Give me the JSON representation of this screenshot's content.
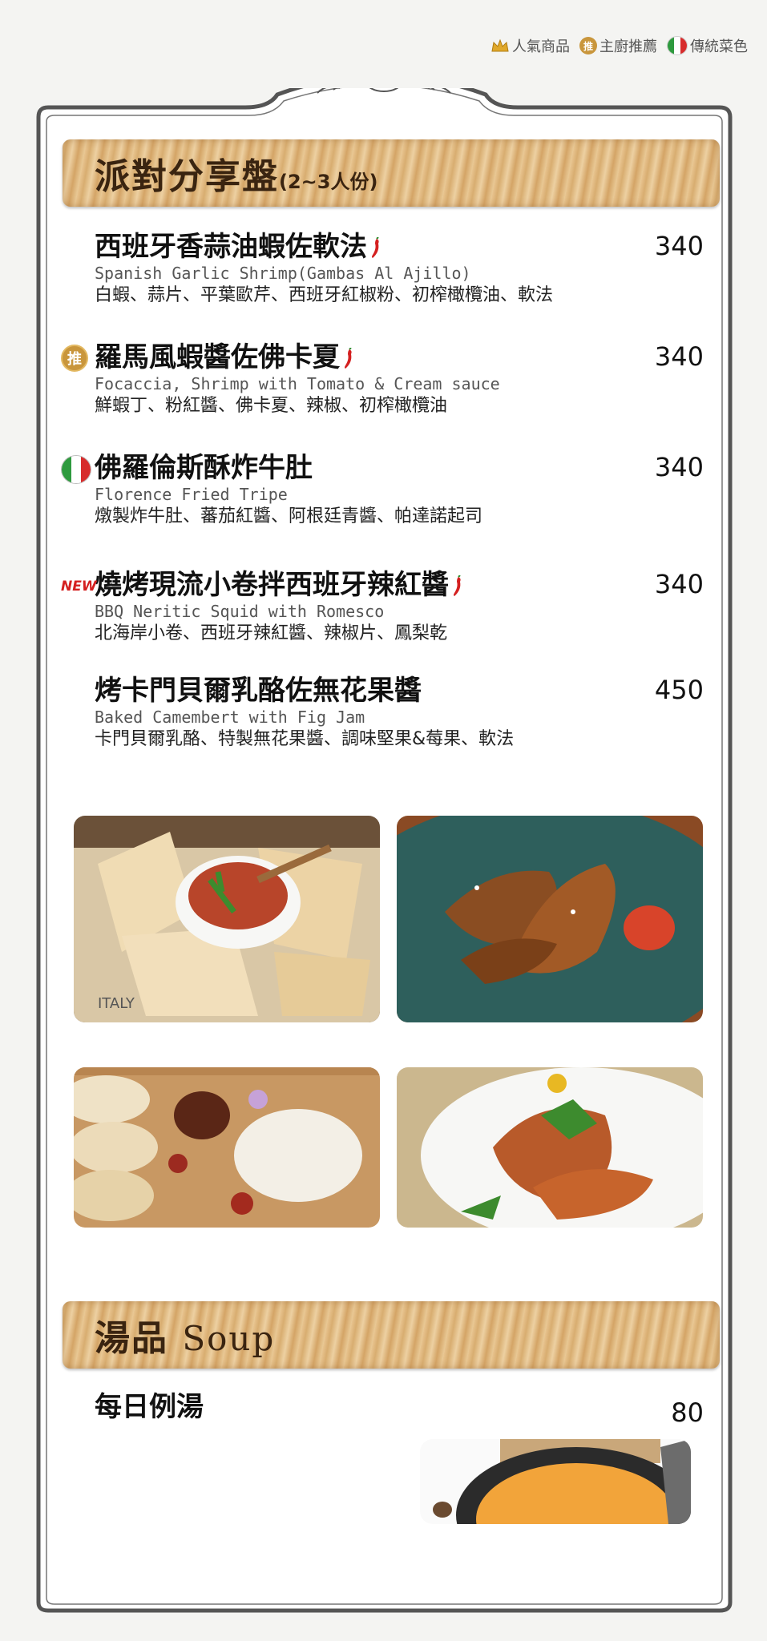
{
  "legend": {
    "popular": "人氣商品",
    "chef": "主廚推薦",
    "chef_badge": "推",
    "traditional": "傳統菜色"
  },
  "section1": {
    "title": "派對分享盤",
    "subtitle": "(2~3人份)"
  },
  "dishes": [
    {
      "name": "西班牙香蒜油蝦佐軟法",
      "en": "Spanish Garlic Shrimp(Gambas Al Ajillo)",
      "ingredients": "白蝦、蒜片、平葉歐芹、西班牙紅椒粉、初榨橄欖油、軟法",
      "price": "340"
    },
    {
      "name": "羅馬風蝦醬佐佛卡夏",
      "en": "Focaccia, Shrimp with Tomato & Cream  sauce",
      "ingredients": "鮮蝦丁、粉紅醬、佛卡夏、辣椒、初榨橄欖油",
      "price": "340",
      "badge": "推"
    },
    {
      "name": "佛羅倫斯酥炸牛肚",
      "en": "Florence Fried Tripe",
      "ingredients": "燉製炸牛肚、蕃茄紅醬、阿根廷青醬、帕達諾起司",
      "price": "340"
    },
    {
      "name": "燒烤現流小卷拌西班牙辣紅醬",
      "en": "BBQ Neritic Squid with Romesco",
      "ingredients": "北海岸小卷、西班牙辣紅醬、辣椒片、鳳梨乾",
      "price": "340",
      "badge": "NEW"
    },
    {
      "name": "烤卡門貝爾乳酪佐無花果醬",
      "en": "Baked Camembert with Fig Jam",
      "ingredients": "卡門貝爾乳酪、特製無花果醬、調味堅果&莓果、軟法",
      "price": "450"
    }
  ],
  "section2": {
    "title": "湯品",
    "title_en": "Soup"
  },
  "soup": {
    "name": "每日例湯",
    "price": "80"
  },
  "photos": {
    "photo1_text": "ITALY"
  },
  "colors": {
    "wood": "#d8ad70",
    "pepper": "#d42020",
    "chef_badge": "#c9963c"
  }
}
